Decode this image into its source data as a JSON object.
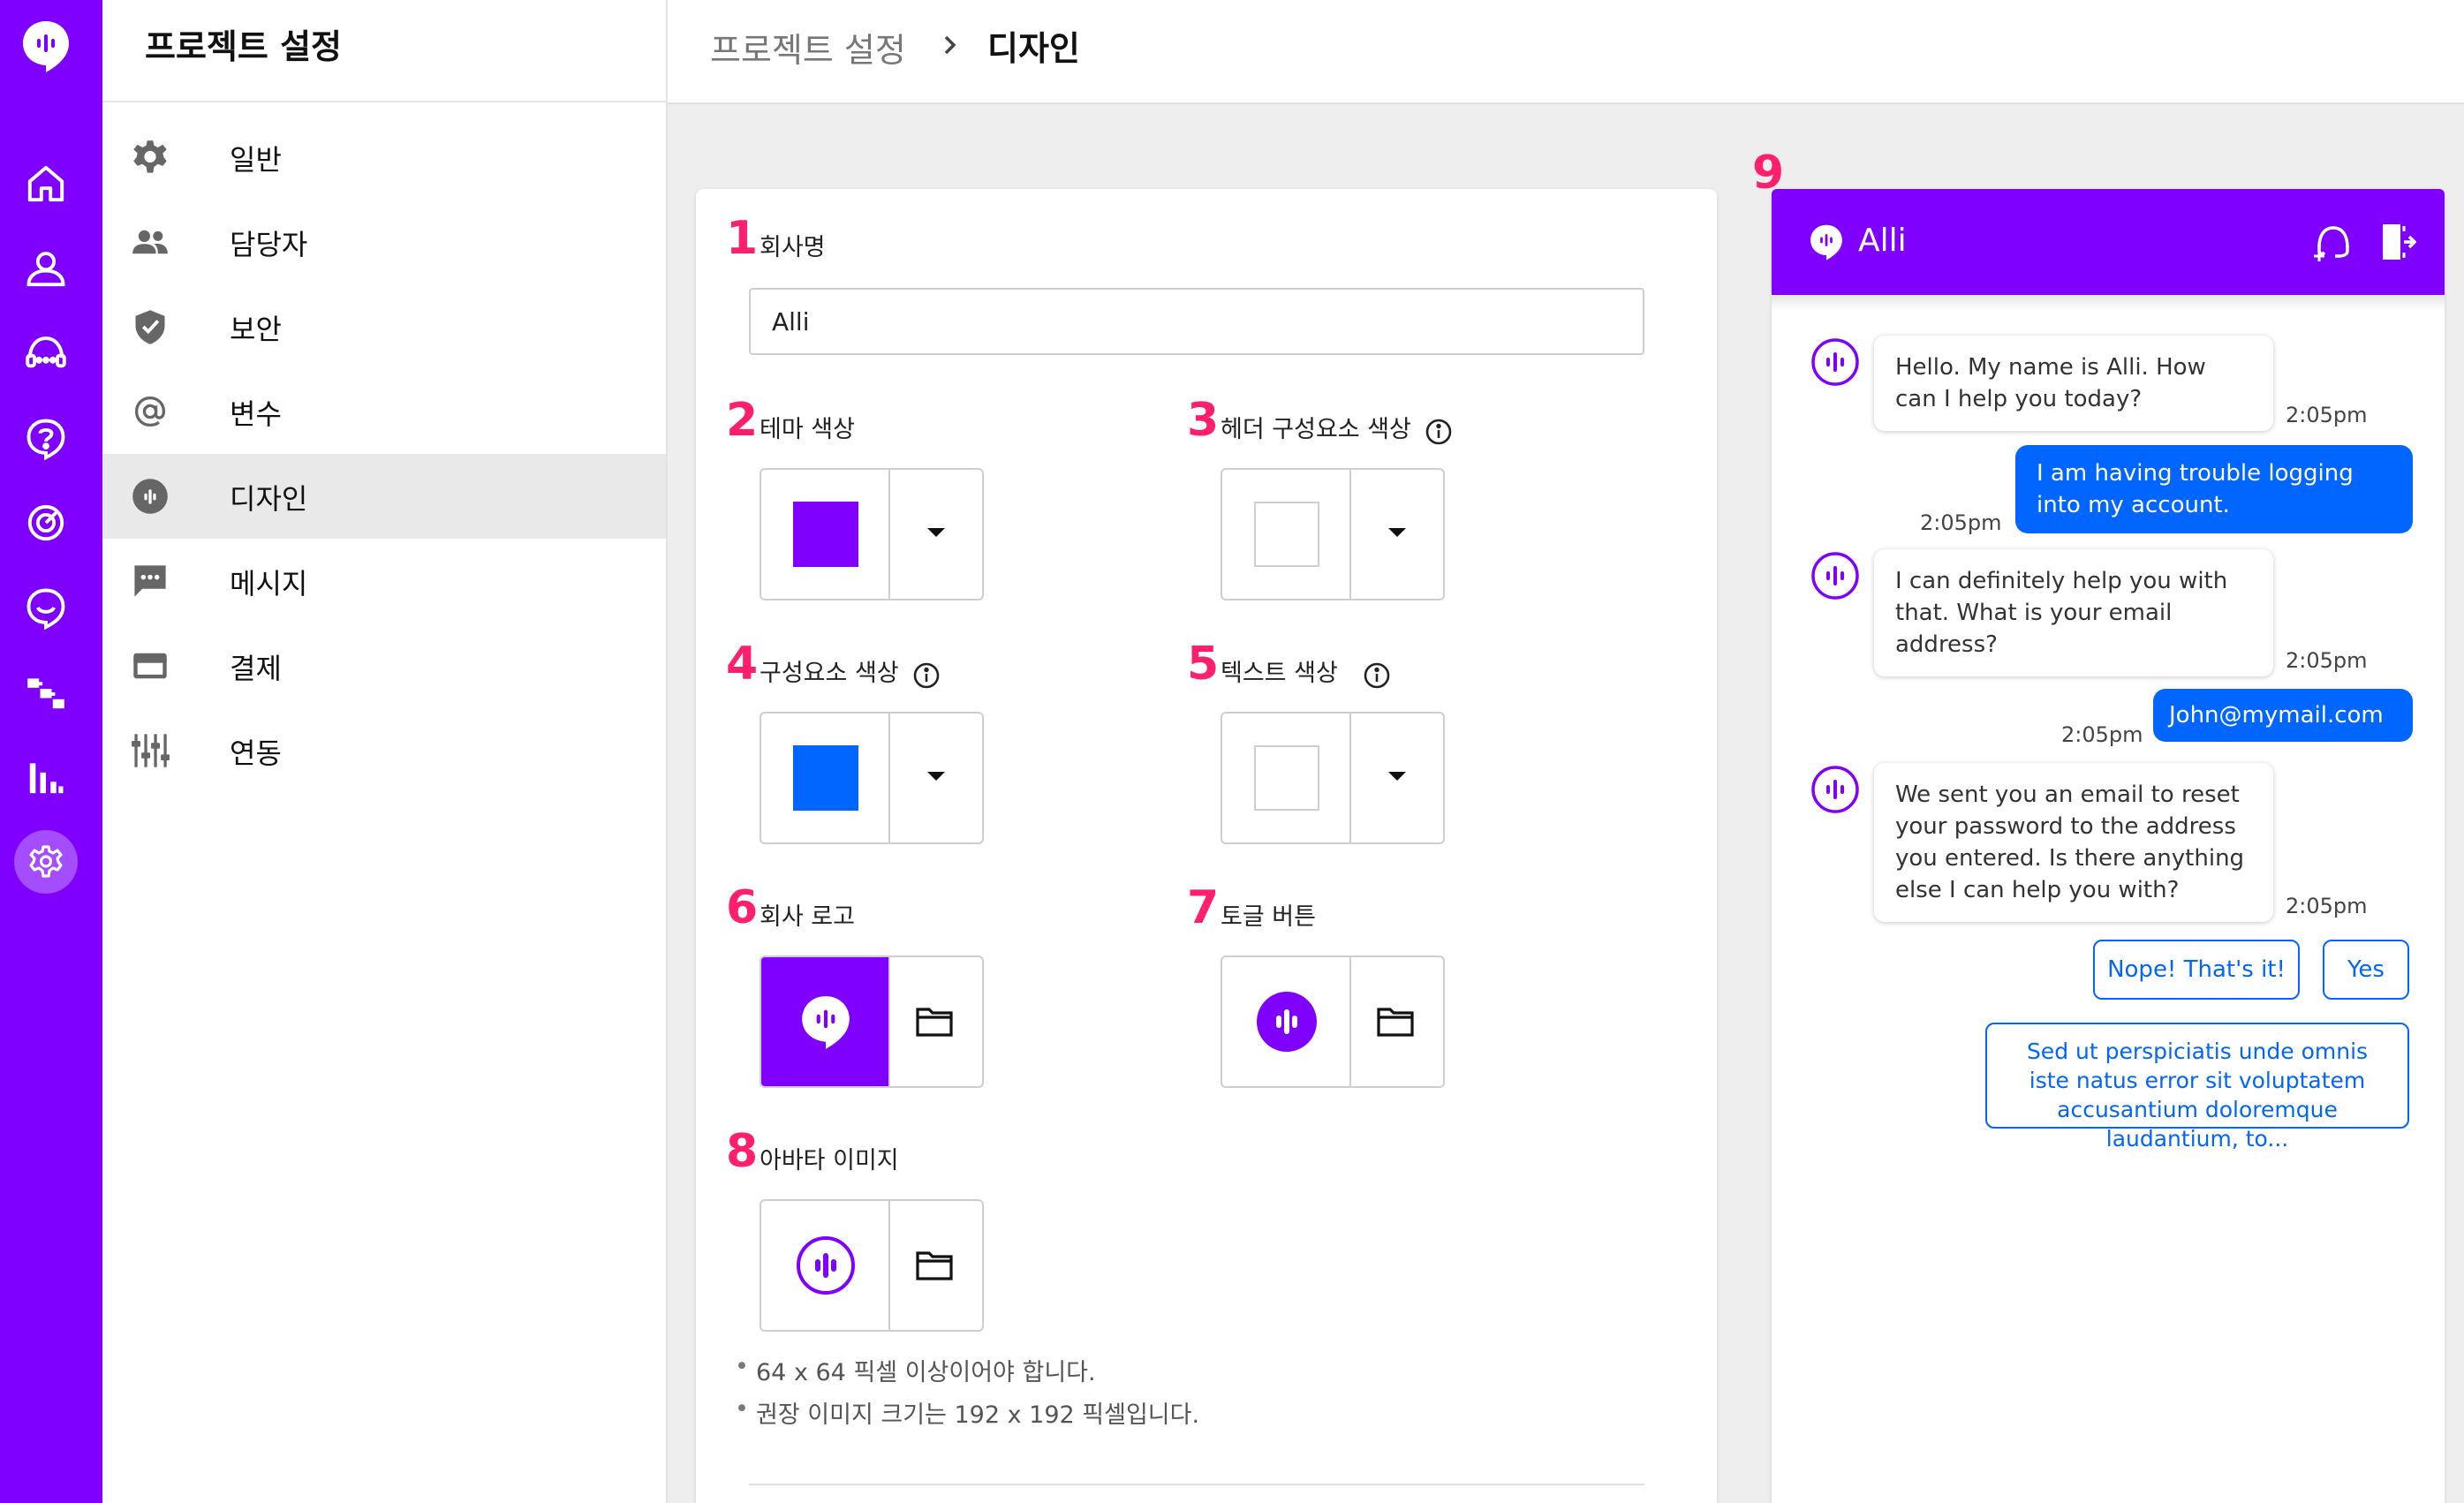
{
  "colors": {
    "brand": "#8000ff",
    "primary": "#0066ff",
    "marker": "#ff1f6e",
    "active_nav_bg": "#e9e9e9"
  },
  "rail": {
    "items": [
      {
        "icon": "home-icon"
      },
      {
        "icon": "users-icon"
      },
      {
        "icon": "live-chat-icon"
      },
      {
        "icon": "faq-icon"
      },
      {
        "icon": "analytics-icon"
      },
      {
        "icon": "conversation-icon"
      },
      {
        "icon": "flow-icon"
      },
      {
        "icon": "bar-chart-icon"
      },
      {
        "icon": "settings-icon",
        "active": true
      }
    ]
  },
  "sidebar": {
    "title": "프로젝트 설정",
    "items": [
      {
        "label": "일반",
        "icon": "gear-icon"
      },
      {
        "label": "담당자",
        "icon": "people-icon"
      },
      {
        "label": "보안",
        "icon": "shield-icon"
      },
      {
        "label": "변수",
        "icon": "at-sign-icon"
      },
      {
        "label": "디자인",
        "icon": "alli-logo-icon",
        "active": true
      },
      {
        "label": "메시지",
        "icon": "message-icon"
      },
      {
        "label": "결제",
        "icon": "credit-card-icon"
      },
      {
        "label": "연동",
        "icon": "integration-icon"
      }
    ]
  },
  "header": {
    "breadcrumb_parent": "프로젝트 설정",
    "breadcrumb_current": "디자인"
  },
  "form": {
    "company_name": {
      "marker": "1",
      "label": "회사명",
      "value": "Alli"
    },
    "theme_color": {
      "marker": "2",
      "label": "테마 색상",
      "color": "#8000ff"
    },
    "header_component_color": {
      "marker": "3",
      "label": "헤더 구성요소 색상",
      "color": "#ffffff"
    },
    "component_color": {
      "marker": "4",
      "label": "구성요소 색상",
      "color": "#0066ff"
    },
    "text_color": {
      "marker": "5",
      "label": "텍스트 색상",
      "color": "#ffffff"
    },
    "company_logo": {
      "marker": "6",
      "label": "회사 로고"
    },
    "toggle_button": {
      "marker": "7",
      "label": "토글 버튼"
    },
    "avatar_image": {
      "marker": "8",
      "label": "아바타 이미지"
    },
    "hints": [
      "64 x 64 픽셀 이상이어야 합니다.",
      "권장 이미지 크기는 192 x 192 픽셀입니다."
    ]
  },
  "preview": {
    "marker": "9",
    "title": "Alli",
    "messages": [
      {
        "from": "bot",
        "text": "Hello. My name is Alli. How can I help you today?",
        "time": "2:05pm"
      },
      {
        "from": "user",
        "text": "I am having trouble logging into my account.",
        "time": "2:05pm"
      },
      {
        "from": "bot",
        "text": "I can definitely help you with that. What is your email address?",
        "time": "2:05pm"
      },
      {
        "from": "user",
        "text": "John@mymail.com",
        "time": "2:05pm"
      },
      {
        "from": "bot",
        "text": "We sent you an email to reset your password to the address you entered. Is there anything else I can help you with?",
        "time": "2:05pm"
      }
    ],
    "quick_replies": [
      "Nope! That's it!",
      "Yes",
      "Sed ut perspiciatis unde omnis iste natus error sit voluptatem accusantium doloremque laudantium, to..."
    ]
  }
}
